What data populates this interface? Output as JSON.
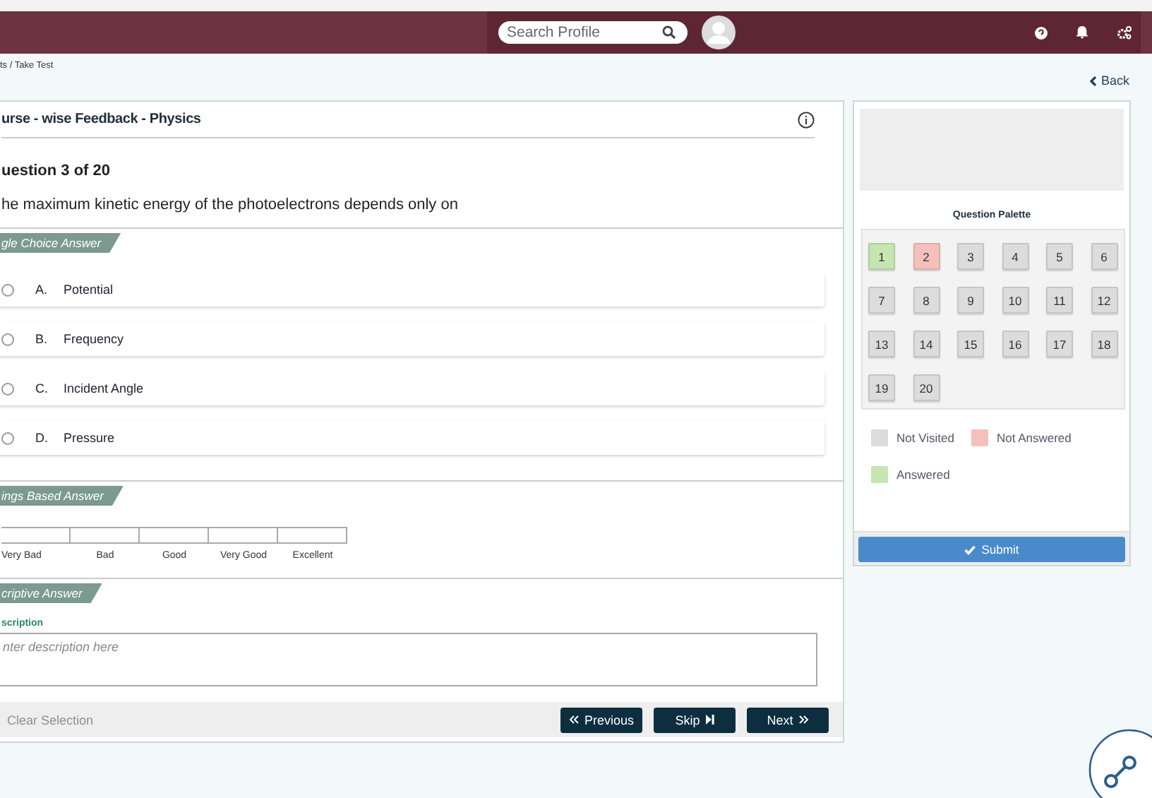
{
  "header": {
    "search": {
      "placeholder": "Search Profile"
    }
  },
  "breadcrumb": "ts / Take Test",
  "back": "Back",
  "quiz": {
    "title": "urse - wise Feedback - Physics",
    "counter": "uestion 3 of 20",
    "question": "he maximum kinetic energy of the photoelectrons depends only on",
    "sections": [
      {
        "kind": "choice",
        "label": "gle Choice Answer",
        "options": [
          {
            "letter": "A.",
            "text": "Potential",
            "selected": false
          },
          {
            "letter": "B.",
            "text": "Frequency",
            "selected": false
          },
          {
            "letter": "C.",
            "text": "Incident Angle",
            "selected": false
          },
          {
            "letter": "D.",
            "text": "Pressure",
            "selected": false
          }
        ]
      },
      {
        "kind": "rating",
        "label": "ings Based Answer",
        "scale": [
          "Very Bad",
          "Bad",
          "Good",
          "Very Good",
          "Excellent"
        ]
      },
      {
        "kind": "text",
        "label": "criptive Answer",
        "field_label": "scription",
        "placeholder": "nter description here"
      }
    ],
    "clear": "Clear Selection",
    "buttons": [
      {
        "kind": "prev",
        "label": "Previous"
      },
      {
        "kind": "skip",
        "label": "Skip"
      },
      {
        "kind": "next",
        "label": "Next"
      }
    ]
  },
  "palette": {
    "title": "Question Palette",
    "questions": [
      {
        "label": "1",
        "color": "#c6e6b1"
      },
      {
        "label": "2",
        "color": "#f5c0bc"
      },
      {
        "label": "3",
        "color": "#dcdcdc"
      },
      {
        "label": "4",
        "color": "#dcdcdc"
      },
      {
        "label": "5",
        "color": "#dcdcdc"
      },
      {
        "label": "6",
        "color": "#dcdcdc"
      },
      {
        "label": "7",
        "color": "#dcdcdc"
      },
      {
        "label": "8",
        "color": "#dcdcdc"
      },
      {
        "label": "9",
        "color": "#dcdcdc"
      },
      {
        "label": "10",
        "color": "#dcdcdc"
      },
      {
        "label": "11",
        "color": "#dcdcdc"
      },
      {
        "label": "12",
        "color": "#dcdcdc"
      },
      {
        "label": "13",
        "color": "#dcdcdc"
      },
      {
        "label": "14",
        "color": "#dcdcdc"
      },
      {
        "label": "15",
        "color": "#dcdcdc"
      },
      {
        "label": "16",
        "color": "#dcdcdc"
      },
      {
        "label": "17",
        "color": "#dcdcdc"
      },
      {
        "label": "18",
        "color": "#dcdcdc"
      },
      {
        "label": "19",
        "color": "#dcdcdc"
      },
      {
        "label": "20",
        "color": "#dcdcdc"
      }
    ],
    "legend": [
      {
        "label": "Not Visited",
        "color": "#dcdcdc"
      },
      {
        "label": "Not Answered",
        "color": "#f5c0bc"
      },
      {
        "label": "Answered",
        "color": "#c6e6b1"
      }
    ],
    "submit": "Submit"
  }
}
